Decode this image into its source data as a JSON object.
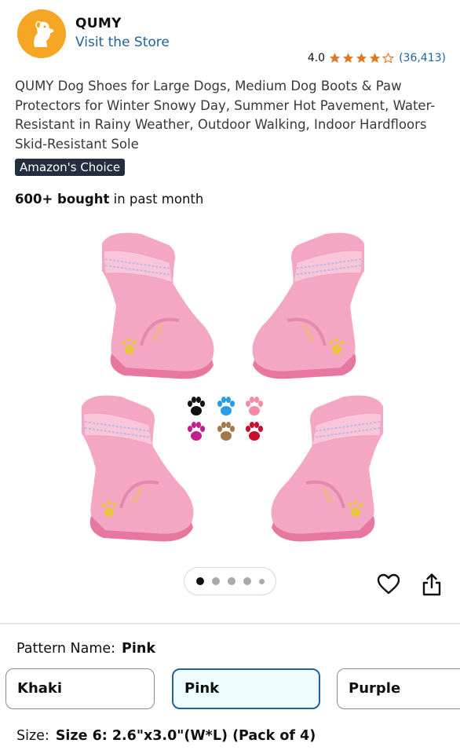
{
  "brand": {
    "name": "QUMY",
    "visit_store": "Visit the Store",
    "logo_icon": "dog-logo-icon",
    "logo_color": "#f5a623"
  },
  "rating": {
    "value": "4.0",
    "stars": 4,
    "max_stars": 5,
    "review_count": "(36,413)",
    "star_color": "#de7921"
  },
  "product": {
    "title": "QUMY Dog Shoes for Large Dogs, Medium Dog Boots & Paw Protectors for Winter Snowy Day, Summer Hot Pavement, Water-Resistant in Rainy Weather, Outdoor Walking, Indoor Hardfloors Skid-Resistant Sole",
    "badge": "Amazon's Choice",
    "bought_bold": "600+ bought",
    "bought_rest": " in past month",
    "image_icon": "pink-dog-boots-image",
    "image_count": 5,
    "image_index": 1
  },
  "actions": {
    "favorite_icon": "heart-icon",
    "share_icon": "share-icon"
  },
  "pattern": {
    "label": "Pattern Name:",
    "selected": "Pink",
    "options": [
      "Khaki",
      "Pink",
      "Purple"
    ]
  },
  "size": {
    "label": "Size:",
    "selected": "Size 6: 2.6\"x3.0\"(W*L) (Pack of 4)"
  },
  "colors": {
    "link": "#2162a1",
    "selected_border": "#2162a1",
    "badge_bg": "#232f3e"
  }
}
